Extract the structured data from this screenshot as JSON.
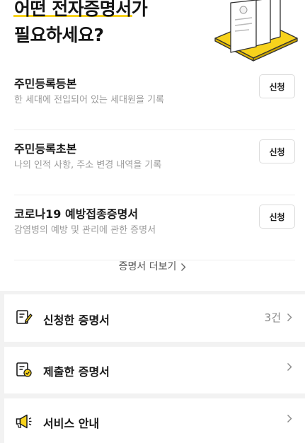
{
  "headline": {
    "line1_highlight": "어떤 전자증명서",
    "line1_rest": "가",
    "line2": "필요하세요?"
  },
  "documents": [
    {
      "title": "주민등록등본",
      "description": "한 세대에 전입되어 있는 세대원을 기록",
      "button": "신청"
    },
    {
      "title": "주민등록초본",
      "description": "나의 인적 사항, 주소 변경 내역을 기록",
      "button": "신청"
    },
    {
      "title": "코로나19 예방접종증명서",
      "description": "감염병의 예방 및 관리에 관한 증명서",
      "button": "신청"
    }
  ],
  "more_label": "증명서 더보기",
  "menu": [
    {
      "label": "신청한 증명서",
      "count": "3건",
      "icon": "document-pencil-icon"
    },
    {
      "label": "제출한 증명서",
      "count": "",
      "icon": "document-check-icon"
    },
    {
      "label": "서비스 안내",
      "count": "",
      "icon": "megaphone-icon"
    }
  ],
  "colors": {
    "accent": "#f7d21c",
    "background": "#f2f2f2"
  }
}
